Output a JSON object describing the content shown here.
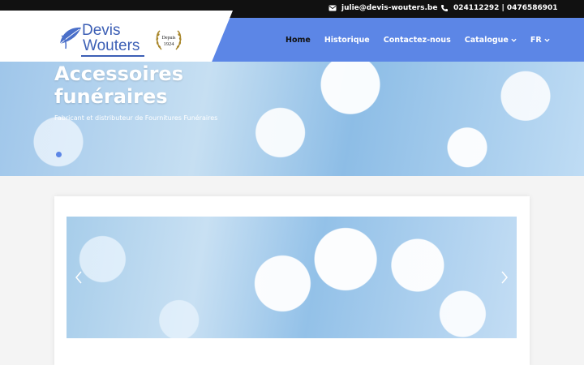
{
  "topbar": {
    "email": "julie@devis-wouters.be",
    "phone": "024112292 | 0476586901"
  },
  "logo": {
    "line1": "Devis",
    "line2": "Wouters",
    "seal_line1": "Depuis",
    "seal_line2": "1924"
  },
  "nav": {
    "items": [
      {
        "label": "Home",
        "active": true
      },
      {
        "label": "Historique"
      },
      {
        "label": "Contactez-nous"
      },
      {
        "label": "Catalogue",
        "dropdown": true
      },
      {
        "label": "FR",
        "dropdown": true
      }
    ]
  },
  "hero": {
    "title_line1": "Accessoires",
    "title_line2": "funéraires",
    "subtitle": "Fabricant et distributeur de Fournitures Funéraires"
  },
  "colors": {
    "nav_bg": "#5c86e6",
    "topbar_bg": "#111111",
    "logo_blue": "#3c5fb5",
    "seal_gold": "#a8862a"
  }
}
